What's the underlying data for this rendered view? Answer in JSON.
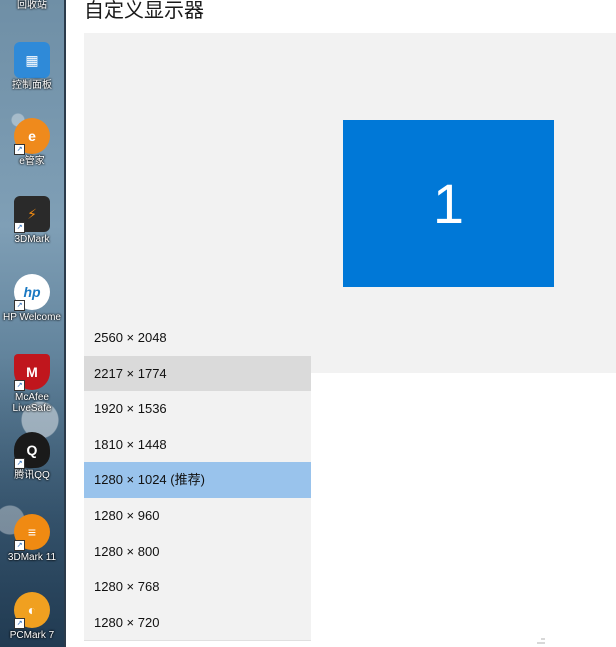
{
  "desktop": {
    "icons": [
      {
        "label": "回收站",
        "icon": "recycle-bin-icon",
        "color": "#8fb0c8",
        "glyph": "♻"
      },
      {
        "label": "控制面板",
        "icon": "control-panel-icon",
        "color": "#2f8ad8",
        "glyph": "▦"
      },
      {
        "label": "e管家",
        "icon": "e-manager-icon",
        "color": "#ef8a1c",
        "glyph": "e"
      },
      {
        "label": "3DMark",
        "icon": "3dmark-icon",
        "color": "#2a2a2a",
        "glyph": "⚡"
      },
      {
        "label": "HP Welcome",
        "icon": "hp-icon",
        "color": "#1a78c2",
        "glyph": "hp"
      },
      {
        "label": "McAfee LiveSafe",
        "icon": "mcafee-icon",
        "color": "#c0161d",
        "glyph": "M"
      },
      {
        "label": "腾讯QQ",
        "icon": "qq-penguin-icon",
        "color": "#1a1a1a",
        "glyph": "Q"
      },
      {
        "label": "3DMark 11",
        "icon": "3dmark11-icon",
        "color": "#f08a12",
        "glyph": "≡"
      },
      {
        "label": "PCMark 7",
        "icon": "pcmark7-icon",
        "color": "#f0a020",
        "glyph": "◐"
      }
    ]
  },
  "page": {
    "title": "自定义显示器"
  },
  "monitor": {
    "label": "1",
    "color": "#0078d7"
  },
  "resolution_dropdown": {
    "options": [
      "2560 × 2048",
      "2217 × 1774",
      "1920 × 1536",
      "1810 × 1448",
      "1280 × 1024 (推荐)",
      "1280 × 960",
      "1280 × 800",
      "1280 × 768",
      "1280 × 720"
    ],
    "hovered": "2217 × 1774",
    "selected": "1280 × 1024 (推荐)"
  }
}
